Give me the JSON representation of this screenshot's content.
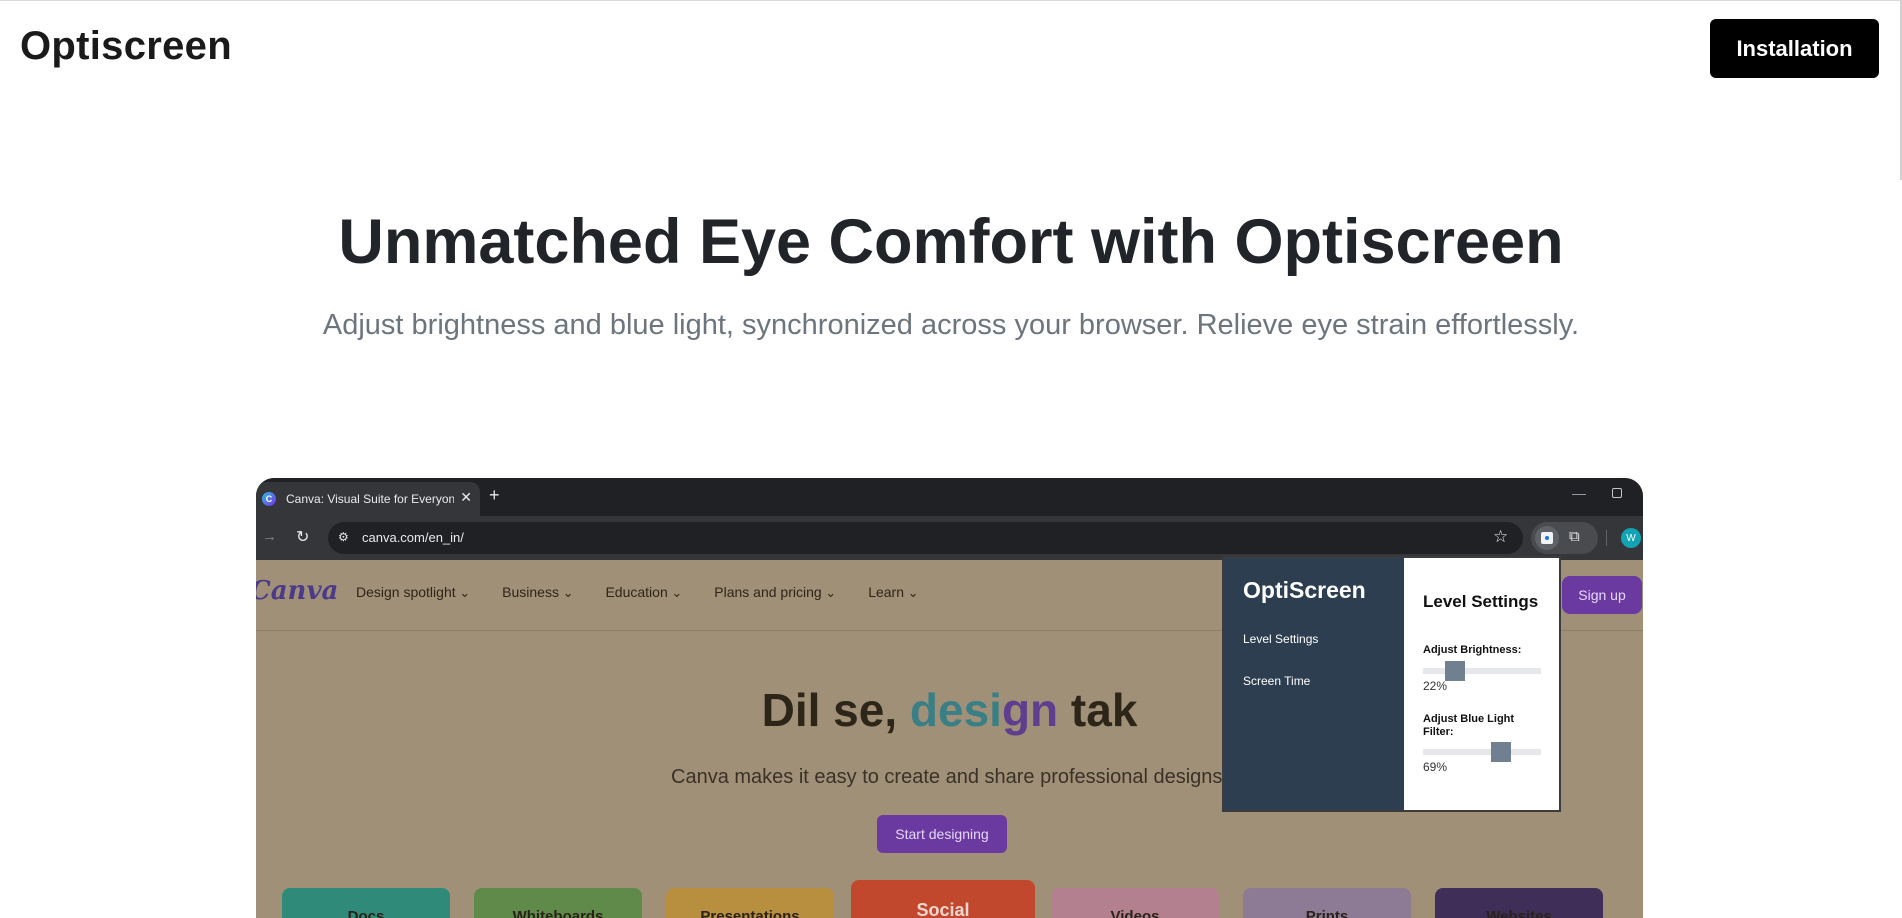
{
  "site": {
    "brand": "Optiscreen",
    "install_label": "Installation"
  },
  "hero": {
    "title": "Unmatched Eye Comfort with Optiscreen",
    "subtitle": "Adjust brightness and blue light, synchronized across your browser. Relieve eye strain effortlessly."
  },
  "browser": {
    "tab_title": "Canva: Visual Suite for Everyone",
    "tab_close": "✕",
    "new_tab": "+",
    "url": "canva.com/en_in/",
    "profile_initial": "W"
  },
  "canva": {
    "logo": "Canva",
    "nav": [
      "Design spotlight",
      "Business",
      "Education",
      "Plans and pricing",
      "Learn"
    ],
    "signup": "Sign up",
    "title_part1": "Dil se, ",
    "title_highlight_a": "desi",
    "title_highlight_b": "gn",
    "title_part2": " tak",
    "description": "Canva makes it easy to create and share professional designs.",
    "cta": "Start designing",
    "cards": [
      "Docs",
      "Whiteboards",
      "Presentations",
      "Social",
      "Videos",
      "Prints",
      "Websites"
    ],
    "card_colors": [
      "#2f8a7a",
      "#5f8a4a",
      "#b88f3e",
      "#c2482d",
      "#b3808f",
      "#8d7b95",
      "#3f2e58"
    ]
  },
  "popup": {
    "brand": "OptiScreen",
    "menu": [
      "Level Settings",
      "Screen Time"
    ],
    "heading": "Level Settings",
    "brightness_label": "Adjust Brightness:",
    "brightness_value": "22%",
    "brightness_fraction": 0.22,
    "bluelight_label": "Adjust Blue Light Filter:",
    "bluelight_value": "69%",
    "bluelight_fraction": 0.69
  }
}
